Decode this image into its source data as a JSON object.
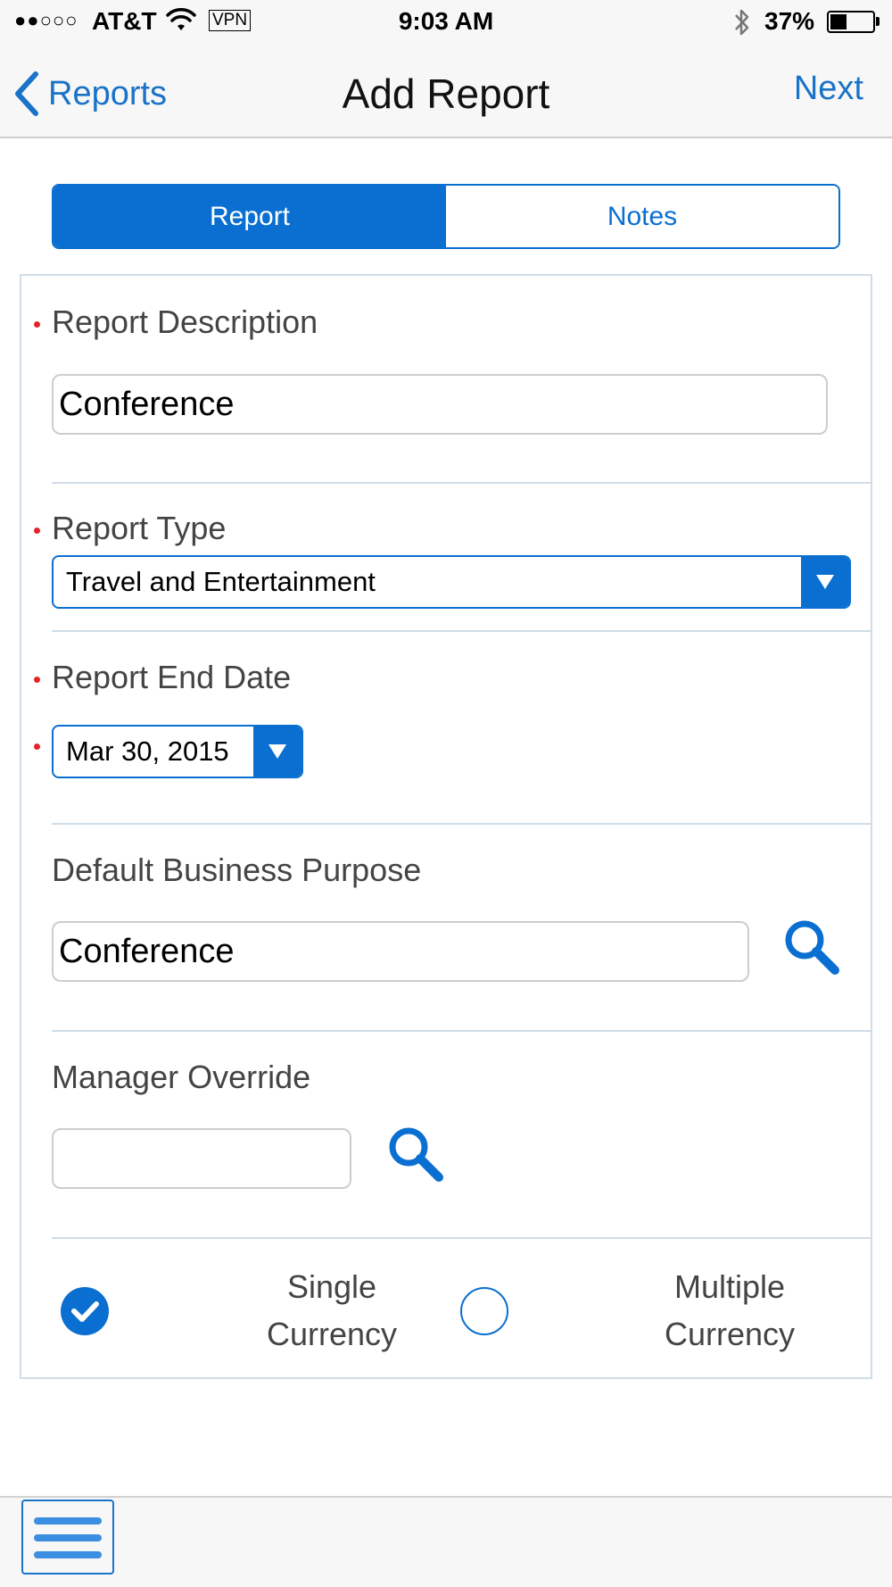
{
  "status_bar": {
    "signal": "●●○○○",
    "carrier": "AT&T",
    "vpn": "VPN",
    "time": "9:03 AM",
    "battery": "37%",
    "battery_level": 0.37
  },
  "nav": {
    "back_label": "Reports",
    "title": "Add Report",
    "next_label": "Next"
  },
  "tabs": [
    {
      "label": "Report",
      "active": true
    },
    {
      "label": "Notes",
      "active": false
    }
  ],
  "form": {
    "report_description": {
      "label": "Report Description",
      "value": "Conference",
      "required": true
    },
    "report_type": {
      "label": "Report Type",
      "value": "Travel and Entertainment",
      "required": true
    },
    "report_end_date": {
      "label": "Report End Date",
      "value": "Mar 30, 2015",
      "required": true
    },
    "business_purpose": {
      "label": "Default Business Purpose",
      "value": "Conference"
    },
    "manager_override": {
      "label": "Manager Override",
      "value": ""
    },
    "currency": {
      "options": [
        {
          "line1": "Single",
          "line2": "Currency",
          "selected": true
        },
        {
          "line1": "Multiple",
          "line2": "Currency",
          "selected": false
        }
      ]
    }
  },
  "icons": {
    "back": "chevron-left-icon",
    "search": "search-icon",
    "dropdown": "triangle-down-icon",
    "check": "check-icon",
    "menu": "hamburger-icon"
  },
  "colors": {
    "accent": "#0a6fd0",
    "link": "#1a73c8",
    "required": "#e3242b",
    "bar_bg": "#f7f7f7"
  }
}
